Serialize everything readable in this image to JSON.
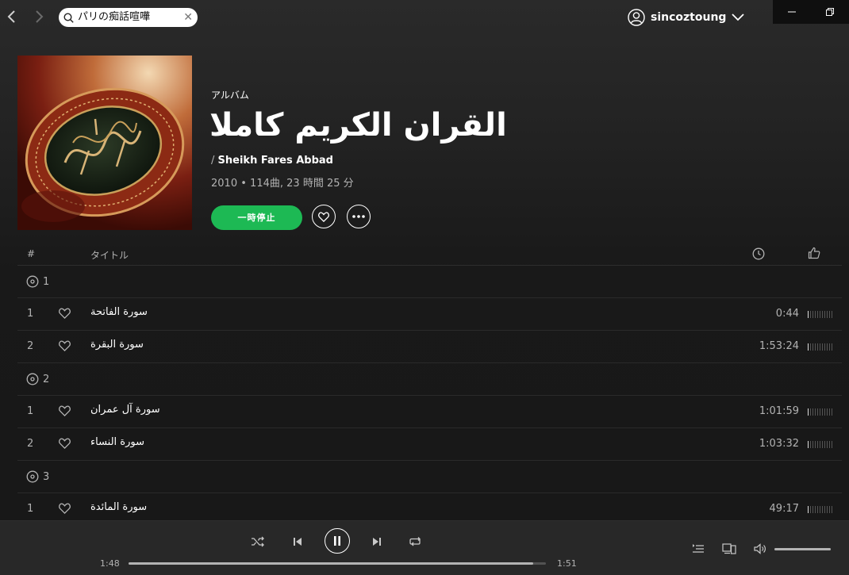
{
  "search": {
    "value": "パリの痴話喧嘩"
  },
  "user": {
    "name": "sincoztoung"
  },
  "album": {
    "type_label": "アルバム",
    "title": "القران الكريم كاملا",
    "artist_prefix": "/",
    "artist": "Sheikh Fares Abbad",
    "year": "2010",
    "bullet": "•",
    "tracks_count": "114曲",
    "total_duration": "23 時間 25 分",
    "pause_label": "一時停止"
  },
  "table": {
    "num_header": "#",
    "title_header": "タイトル"
  },
  "discs": [
    {
      "number": "1",
      "tracks": [
        {
          "number": "1",
          "title": "سورة الفاتحة",
          "duration": "0:44"
        },
        {
          "number": "2",
          "title": "سورة البقرة",
          "duration": "1:53:24"
        }
      ]
    },
    {
      "number": "2",
      "tracks": [
        {
          "number": "1",
          "title": "سورة آل عمران",
          "duration": "1:01:59"
        },
        {
          "number": "2",
          "title": "سورة النساء",
          "duration": "1:03:32"
        }
      ]
    },
    {
      "number": "3",
      "tracks": [
        {
          "number": "1",
          "title": "سورة المائدة",
          "duration": "49:17"
        }
      ]
    }
  ],
  "player": {
    "elapsed": "1:48",
    "total": "1:51",
    "progress_fraction": 0.97,
    "volume_fraction": 1.0
  },
  "colors": {
    "accent": "#1db954",
    "background": "#181818",
    "player_bar": "#282828"
  },
  "icons": {
    "back": "chevron-left-icon",
    "forward": "chevron-right-icon",
    "search": "search-icon",
    "clear": "close-icon",
    "user": "user-icon",
    "menu": "chevron-down-icon",
    "like": "heart-icon",
    "more": "more-icon",
    "disc": "disc-icon",
    "clock": "clock-icon",
    "popularity": "thumb-up-icon",
    "shuffle": "shuffle-icon",
    "previous": "previous-icon",
    "pause": "pause-icon",
    "next": "next-icon",
    "repeat": "repeat-icon",
    "queue": "queue-icon",
    "devices": "devices-icon",
    "volume": "volume-icon"
  }
}
